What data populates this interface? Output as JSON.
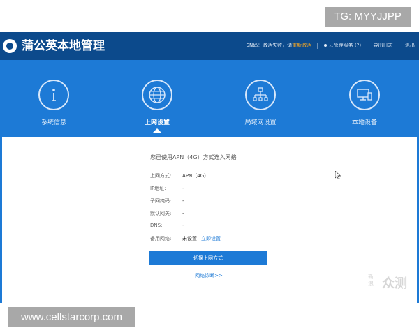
{
  "overlay": {
    "tg_tag": "TG: MYYJJPP",
    "url_tag": "www.cellstarcorp.com",
    "watermark_main": "众测",
    "watermark_small": "新浪"
  },
  "header": {
    "brand": "蒲公英本地管理",
    "sn_prefix": "SN码：激活失败，请",
    "sn_action": "重新激活",
    "cloud_service": "云管理服务 (?)",
    "export_log": "导出日志",
    "logout": "退出"
  },
  "nav": {
    "items": [
      {
        "label": "系统信息",
        "icon": "info-icon"
      },
      {
        "label": "上网设置",
        "icon": "globe-icon",
        "active": true
      },
      {
        "label": "局域网设置",
        "icon": "network-icon"
      },
      {
        "label": "本地设备",
        "icon": "monitor-icon"
      }
    ]
  },
  "main": {
    "headline": "您已使用APN（4G）方式连入网络",
    "rows": [
      {
        "label": "上网方式:",
        "value": "APN（4G）"
      },
      {
        "label": "IP地址:",
        "value": "-"
      },
      {
        "label": "子网掩码:",
        "value": "-"
      },
      {
        "label": "默认网关:",
        "value": "-"
      },
      {
        "label": "DNS:",
        "value": "-"
      },
      {
        "label": "备用网络:",
        "value": "未设置",
        "link": "立即设置"
      }
    ],
    "switch_button": "切换上网方式",
    "diagnose_link": "网络诊断>>"
  },
  "colors": {
    "topbar": "#0c4a8c",
    "primary": "#1d7ad6",
    "warning": "#f5a623"
  }
}
